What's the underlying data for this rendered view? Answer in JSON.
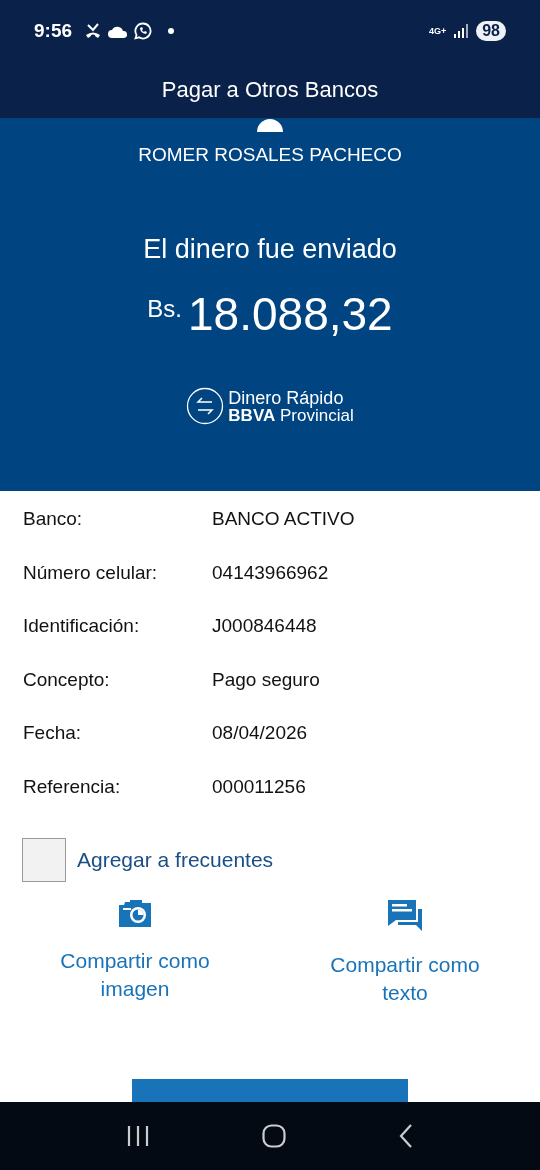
{
  "status_bar": {
    "time": "9:56",
    "network": "4G+",
    "battery": "98"
  },
  "header": {
    "title": "Pagar a Otros Bancos"
  },
  "summary": {
    "recipient": "ROMER ROSALES PACHECO",
    "message": "El dinero fue enviado",
    "currency": "Bs.",
    "amount": "18.088,32",
    "brand": {
      "line1": "Dinero Rápido",
      "line2_bold": "BBVA",
      "line2": "Provincial"
    }
  },
  "details": [
    {
      "label": "Banco:",
      "value": "BANCO ACTIVO"
    },
    {
      "label": "Número celular:",
      "value": "04143966962"
    },
    {
      "label": "Identificación:",
      "value": "J000846448"
    },
    {
      "label": "Concepto:",
      "value": "Pago seguro"
    },
    {
      "label": "Fecha:",
      "value": "08/04/2026"
    },
    {
      "label": "Referencia:",
      "value": "000011256"
    }
  ],
  "favorite": {
    "label": "Agregar a frecuentes",
    "checked": false
  },
  "share": [
    {
      "kind": "image",
      "label": "Compartir como imagen"
    },
    {
      "kind": "text",
      "label": "Compartir como texto"
    }
  ]
}
